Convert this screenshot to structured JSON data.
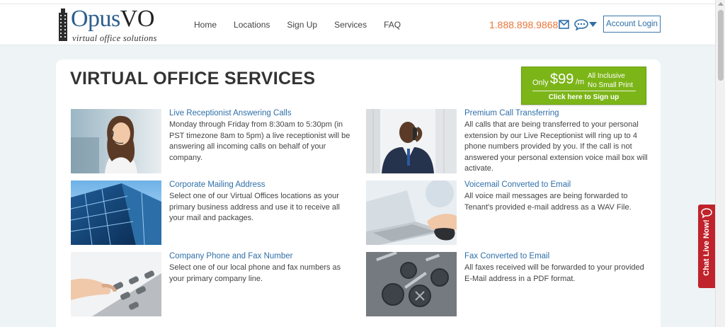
{
  "logo": {
    "name_part1": "Opus",
    "name_part2": "VO",
    "tagline": "virtual office solutions"
  },
  "nav": [
    {
      "label": "Home"
    },
    {
      "label": "Locations"
    },
    {
      "label": "Sign Up"
    },
    {
      "label": "Services"
    },
    {
      "label": "FAQ"
    }
  ],
  "header": {
    "phone": "1.888.898.9868",
    "login_label": "Account Login",
    "accent_color": "#e8773b",
    "link_color": "#2f6fa8"
  },
  "page": {
    "title": "VIRTUAL OFFICE SERVICES"
  },
  "promo": {
    "only": "Only",
    "price": "$99",
    "per": "/m",
    "all_inclusive": "All Inclusive",
    "no_small_print": "No Small Print",
    "cta": "Click here to Sign up",
    "color": "#7cb518"
  },
  "services": [
    {
      "title": "Live Receptionist Answering Calls",
      "description": "Monday through Friday from 8:30am to 5:30pm (in PST timezone 8am to 5pm) a live receptionist will be answering all incoming calls on behalf of your company."
    },
    {
      "title": "Premium Call Transferring",
      "description": "All calls that are being transferred to your personal extension by our Live Receptionist will ring up to 4 phone numbers provided by you. If the call is not answered your personal extension voice mail box will activate."
    },
    {
      "title": "Corporate Mailing Address",
      "description": "Select one of our Virtual Offices locations as your primary business address and use it to receive all your mail and packages."
    },
    {
      "title": "Voicemail Converted to Email",
      "description": "All voice mail messages are being forwarded to Tenant's provided e-mail address as a WAV File."
    },
    {
      "title": "Company Phone and Fax Number",
      "description": "Select one of our local phone and fax numbers as your primary company line."
    },
    {
      "title": "Fax Converted to Email",
      "description": "All faxes received will be forwarded to your provided E-Mail address in a PDF format."
    }
  ],
  "chat": {
    "label": "Chat Live Now!",
    "color": "#c0232b"
  }
}
